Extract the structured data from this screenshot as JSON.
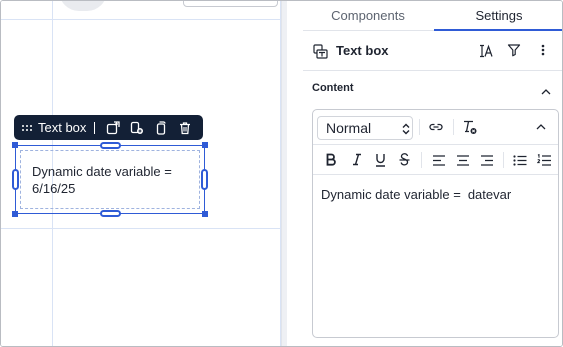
{
  "canvas": {
    "toolbar_label": "Text box",
    "textbox_text": "Dynamic date variable = 6/16/25"
  },
  "panel": {
    "tabs": [
      {
        "label": "Components",
        "active": false
      },
      {
        "label": "Settings",
        "active": true
      }
    ],
    "header_title": "Text box",
    "section_title": "Content",
    "editor": {
      "paragraph_style": "Normal",
      "body_text": "Dynamic date variable =",
      "variable_chip": "datevar"
    }
  },
  "colors": {
    "accent": "#2f5bd6",
    "toolbar_bg": "#132036"
  }
}
